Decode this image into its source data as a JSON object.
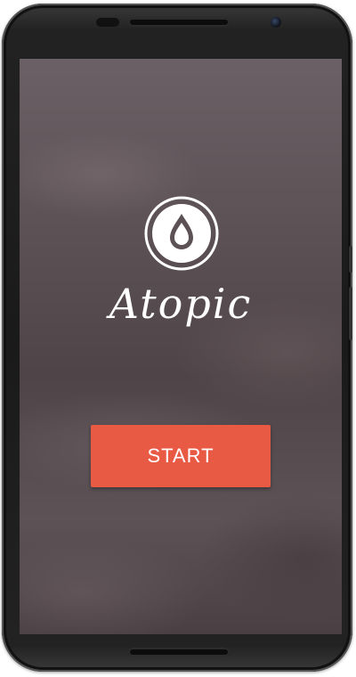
{
  "app": {
    "title": "Atopic",
    "logo_icon": "water-drop-icon"
  },
  "start_button": {
    "label": "START"
  },
  "colors": {
    "accent": "#e95a45",
    "text": "#ffffff",
    "background": "#5c5155"
  }
}
